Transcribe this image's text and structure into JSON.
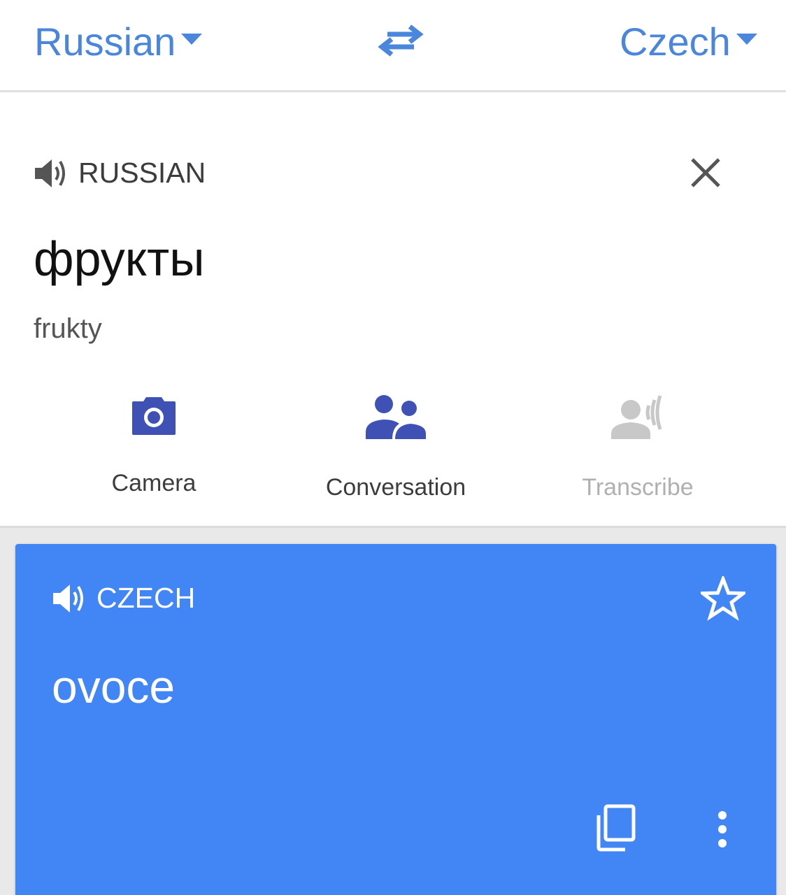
{
  "header": {
    "source_language": "Russian",
    "target_language": "Czech",
    "swap_icon": "swap-arrows-icon"
  },
  "input": {
    "language_label": "RUSSIAN",
    "text": "фрукты",
    "transliteration": "frukty"
  },
  "tools": {
    "camera_label": "Camera",
    "conversation_label": "Conversation",
    "transcribe_label": "Transcribe"
  },
  "result": {
    "language_label": "CZECH",
    "text": "ovoce"
  },
  "colors": {
    "accent": "#4a86dc",
    "result_background": "#4285f4",
    "tool_icon": "#3f51b5",
    "tool_disabled": "#b0b0b0"
  }
}
